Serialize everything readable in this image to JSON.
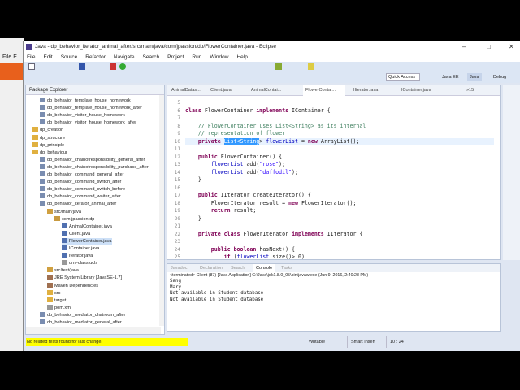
{
  "background_window": {
    "menu_label": "File E"
  },
  "window": {
    "title": "Java - dp_behavior_iterator_animal_after/src/main/java/com/jpassion/dp/FlowerContainer.java - Eclipse"
  },
  "menu": [
    "File",
    "Edit",
    "Source",
    "Refactor",
    "Navigate",
    "Search",
    "Project",
    "Run",
    "Window",
    "Help"
  ],
  "perspective": {
    "quick_access": "Quick Access",
    "items": [
      "Java EE",
      "Java",
      "Debug"
    ]
  },
  "package_explorer": {
    "title": "Package Explorer",
    "items": [
      {
        "label": "dp_behavior_template_house_homework",
        "level": 1,
        "type": "project"
      },
      {
        "label": "dp_behavior_template_house_homework_after",
        "level": 1,
        "type": "project"
      },
      {
        "label": "dp_behavior_visitor_house_homework",
        "level": 1,
        "type": "project"
      },
      {
        "label": "dp_behavior_visitor_house_homework_after",
        "level": 1,
        "type": "project"
      },
      {
        "label": "dp_creation",
        "level": 0,
        "type": "folder"
      },
      {
        "label": "dp_structure",
        "level": 0,
        "type": "folder"
      },
      {
        "label": "dp_principle",
        "level": 0,
        "type": "folder"
      },
      {
        "label": "dp_behaviour",
        "level": 0,
        "type": "folder"
      },
      {
        "label": "dp_behavior_chainofresponsibility_general_after",
        "level": 1,
        "type": "project"
      },
      {
        "label": "dp_behavior_chainofresponsibility_purchase_after",
        "level": 1,
        "type": "project"
      },
      {
        "label": "dp_behavior_command_general_after",
        "level": 1,
        "type": "project"
      },
      {
        "label": "dp_behavior_command_switch_after",
        "level": 1,
        "type": "project"
      },
      {
        "label": "dp_behavior_command_switch_before",
        "level": 1,
        "type": "project"
      },
      {
        "label": "dp_behavior_command_waiter_after",
        "level": 1,
        "type": "project"
      },
      {
        "label": "dp_behavior_iterator_animal_after",
        "level": 1,
        "type": "project"
      },
      {
        "label": "src/main/java",
        "level": 2,
        "type": "src"
      },
      {
        "label": "com.jpassion.dp",
        "level": 3,
        "type": "package"
      },
      {
        "label": "AnimalContainer.java",
        "level": 4,
        "type": "java"
      },
      {
        "label": "Client.java",
        "level": 4,
        "type": "java"
      },
      {
        "label": "FlowerContainer.java",
        "level": 4,
        "type": "java",
        "selected": true
      },
      {
        "label": "IContainer.java",
        "level": 4,
        "type": "java"
      },
      {
        "label": "Iterator.java",
        "level": 4,
        "type": "java"
      },
      {
        "label": "uml-class.ucls",
        "level": 4,
        "type": "file"
      },
      {
        "label": "src/test/java",
        "level": 2,
        "type": "src"
      },
      {
        "label": "JRE System Library [JavaSE-1.7]",
        "level": 2,
        "type": "lib"
      },
      {
        "label": "Maven Dependencies",
        "level": 2,
        "type": "lib"
      },
      {
        "label": "src",
        "level": 2,
        "type": "folder"
      },
      {
        "label": "target",
        "level": 2,
        "type": "folder"
      },
      {
        "label": "pom.xml",
        "level": 2,
        "type": "file"
      },
      {
        "label": "dp_behavior_mediator_chatroom_after",
        "level": 1,
        "type": "project"
      },
      {
        "label": "dp_behavior_mediator_general_after",
        "level": 1,
        "type": "project"
      }
    ]
  },
  "editor": {
    "tabs": [
      "AnimalDatas...",
      "Client.java",
      "AnimalContai...",
      "FlowerContai...",
      "IIterator.java",
      "IContainer.java"
    ],
    "overflow": "»15",
    "active_tab": 3,
    "lines": [
      {
        "n": "5",
        "html": ""
      },
      {
        "n": "6",
        "html": "<span class='kw'>class</span> FlowerContainer <span class='kw'>implements</span> IContainer {"
      },
      {
        "n": "7",
        "html": ""
      },
      {
        "n": "8",
        "html": "    <span class='cm'>// FlowerContainer uses List&lt;String&gt; as its internal</span>"
      },
      {
        "n": "9",
        "html": "    <span class='cm'>// representation of flower</span>"
      },
      {
        "n": "10",
        "html": "    <span class='kw'>private</span> <span class='sel'>List&lt;String</span>&gt; <span class='fd'>flowerList</span> = <span class='kw'>new</span> ArrayList();"
      },
      {
        "n": "11",
        "html": ""
      },
      {
        "n": "12",
        "html": "    <span class='kw'>public</span> FlowerContainer() {"
      },
      {
        "n": "13",
        "html": "        <span class='fd'>flowerList</span>.add(<span class='st'>\"rose\"</span>);"
      },
      {
        "n": "14",
        "html": "        <span class='fd'>flowerList</span>.add(<span class='st'>\"daffodil\"</span>);"
      },
      {
        "n": "15",
        "html": "    }"
      },
      {
        "n": "16",
        "html": ""
      },
      {
        "n": "17",
        "html": "    <span class='kw'>public</span> IIterator createIterator() {"
      },
      {
        "n": "18",
        "html": "        FlowerIterator result = <span class='kw'>new</span> FlowerIterator();"
      },
      {
        "n": "19",
        "html": "        <span class='kw'>return</span> result;"
      },
      {
        "n": "20",
        "html": "    }"
      },
      {
        "n": "21",
        "html": ""
      },
      {
        "n": "22",
        "html": "    <span class='kw'>private</span> <span class='kw'>class</span> FlowerIterator <span class='kw'>implements</span> IIterator {"
      },
      {
        "n": "23",
        "html": ""
      },
      {
        "n": "24",
        "html": "        <span class='kw'>public</span> <span class='kw'>boolean</span> hasNext() {"
      },
      {
        "n": "25",
        "html": "            <span class='kw'>if</span> (<span class='fd'>flowerList</span>.size()&gt; 0)"
      }
    ]
  },
  "console": {
    "tabs": [
      "Javadoc",
      "Declaration",
      "Search",
      "Console",
      "Tasks"
    ],
    "active_tab": 3,
    "header": "<terminated> Client (87) [Java Application] C:\\Java\\jdk1.8.0_05\\bin\\javaw.exe (Jun 9, 2016, 2:40:28 PM)",
    "output": [
      "Sang",
      "Mary",
      "Not available in Student database",
      "Not available in Student database"
    ]
  },
  "status": {
    "message": "No related tests found for last change.",
    "writable": "Writable",
    "insert_mode": "Smart Insert",
    "position": "10 : 24"
  }
}
